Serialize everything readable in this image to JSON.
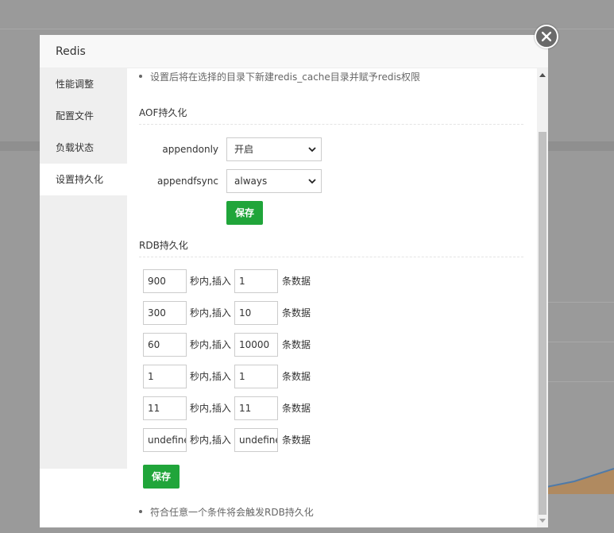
{
  "dialog": {
    "title": "Redis"
  },
  "sidebar": {
    "items": [
      {
        "label": "性能调整"
      },
      {
        "label": "配置文件"
      },
      {
        "label": "负载状态"
      },
      {
        "label": "设置持久化"
      }
    ],
    "active_index": 3
  },
  "content": {
    "top_note": "设置后将在选择的目录下新建redis_cache目录并赋予redis权限",
    "aof": {
      "title": "AOF持久化",
      "appendonly_label": "appendonly",
      "appendonly_value": "开启",
      "appendfsync_label": "appendfsync",
      "appendfsync_value": "always",
      "save_label": "保存"
    },
    "rdb": {
      "title": "RDB持久化",
      "text_seconds": "秒内,插入",
      "text_records": "条数据",
      "rules": [
        {
          "seconds": "900",
          "changes": "1"
        },
        {
          "seconds": "300",
          "changes": "10"
        },
        {
          "seconds": "60",
          "changes": "10000"
        },
        {
          "seconds": "1",
          "changes": "1"
        },
        {
          "seconds": "11",
          "changes": "11"
        },
        {
          "seconds": "undefined",
          "changes": "undefined"
        }
      ],
      "save_label": "保存",
      "note": "符合任意一个条件将会触发RDB持久化"
    }
  },
  "colors": {
    "accent_green": "#20a53a",
    "overlay": "#9a9a9a"
  }
}
